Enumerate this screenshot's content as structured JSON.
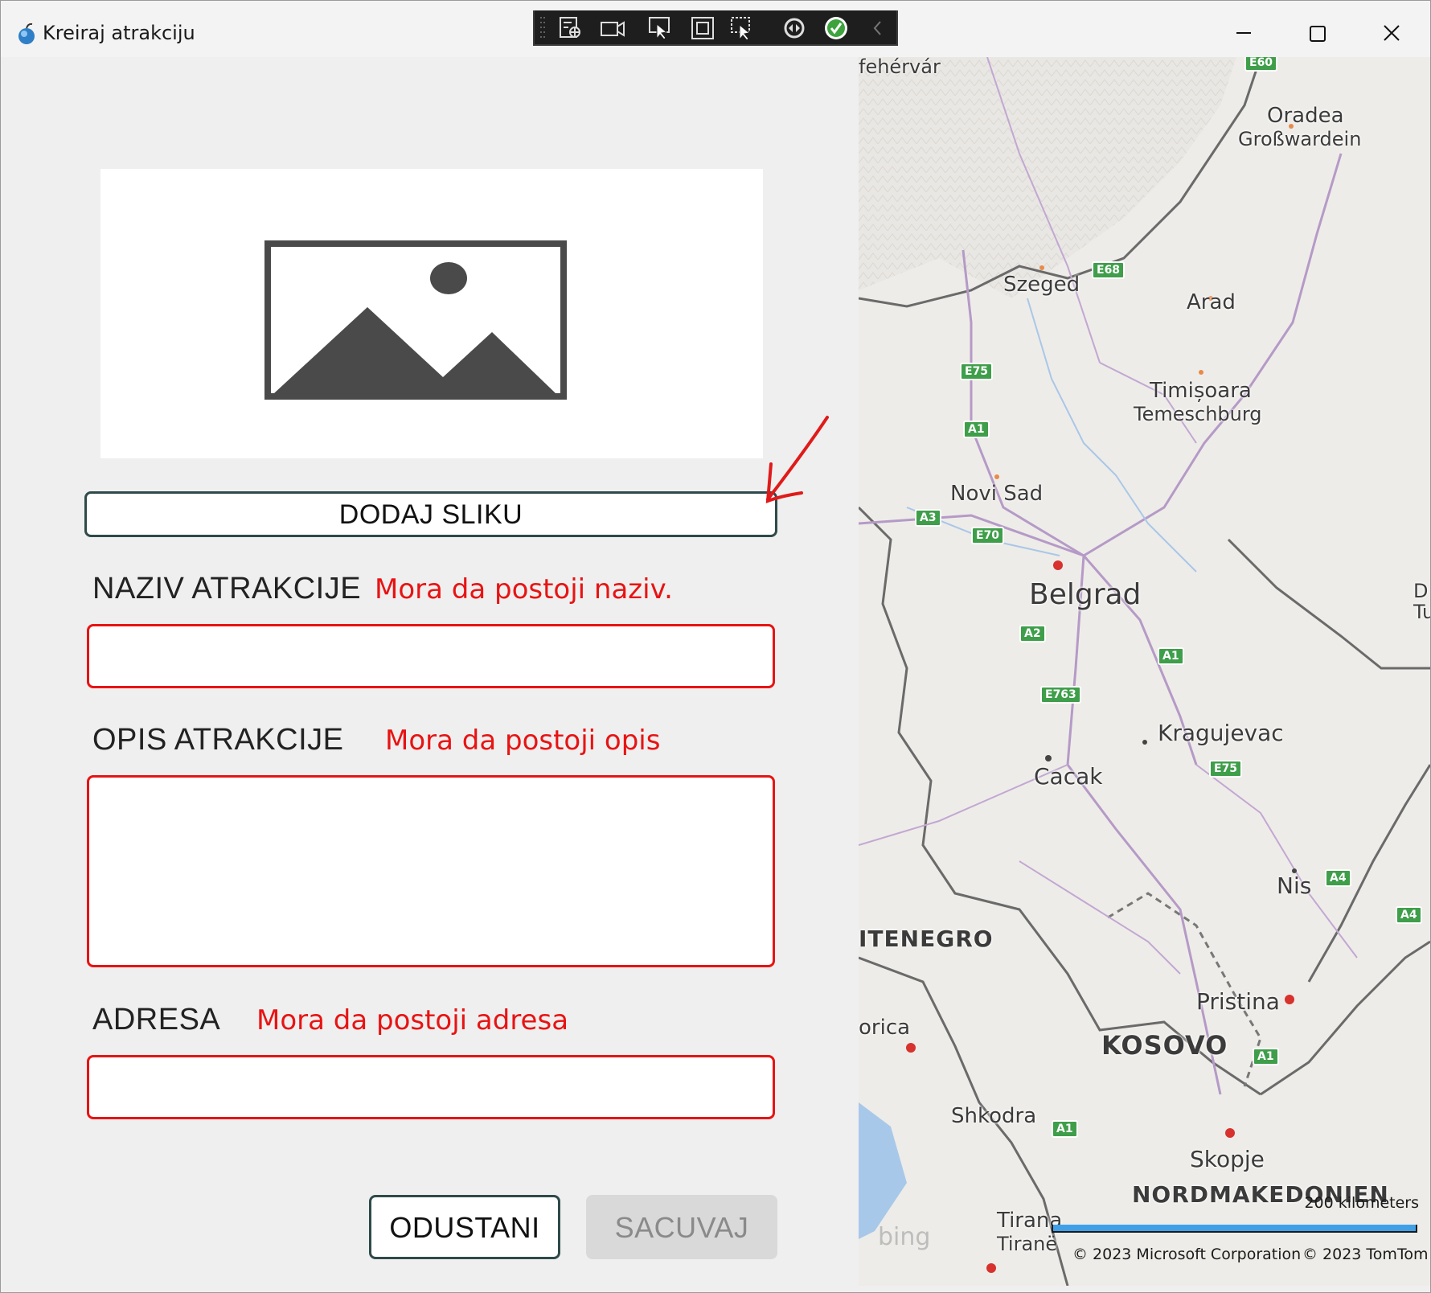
{
  "window": {
    "title": "Kreiraj atrakciju"
  },
  "form": {
    "add_image_label": "DODAJ SLIKU",
    "name_label": "NAZIV ATRAKCIJE",
    "name_error": "Mora da postoji naziv.",
    "name_value": "",
    "description_label": "OPIS ATRAKCIJE",
    "description_error": "Mora da postoji opis",
    "description_value": "",
    "address_label": "ADRESA",
    "address_error": "Mora da postoji adresa",
    "address_value": "",
    "cancel_label": "ODUSTANI",
    "save_label": "SACUVAJ"
  },
  "map": {
    "cities": {
      "fehervar": "fehérvár",
      "oradea": "Oradea",
      "grosswardein": "Großwardein",
      "szeged": "Szeged",
      "arad": "Arad",
      "timisoara": "Timișoara",
      "temeschburg": "Temeschburg",
      "novi_sad": "Novi Sad",
      "belgrad": "Belgrad",
      "kragujevac": "Kragujevac",
      "cacak": "Cacak",
      "nis": "Nis",
      "pristina": "Pristina",
      "shkodra": "Shkodra",
      "skopje": "Skopje",
      "tirana": "Tirana",
      "tirane": "Tiranë",
      "orica": "orica",
      "d": "D",
      "tu": "Tu"
    },
    "countries": {
      "montenegro": "ITENEGRO",
      "kosovo": "KOSOVO",
      "north_macedonia": "NORDMAKEDONIEN"
    },
    "shields": [
      "E60",
      "E68",
      "E75",
      "A1",
      "A3",
      "E70",
      "A2",
      "A1",
      "E763",
      "E75",
      "A4",
      "A4",
      "A1",
      "A1"
    ],
    "scale_label": "200 kilometers",
    "copyright_ms": "© 2023 Microsoft Corporation",
    "copyright_tomtom": "© 2023 TomTom",
    "provider": "bing"
  },
  "colors": {
    "error": "#e81313",
    "button_border": "#2f4a4a",
    "save_disabled_bg": "#d9d9d9",
    "annotation_arrow": "#e01a1a"
  }
}
